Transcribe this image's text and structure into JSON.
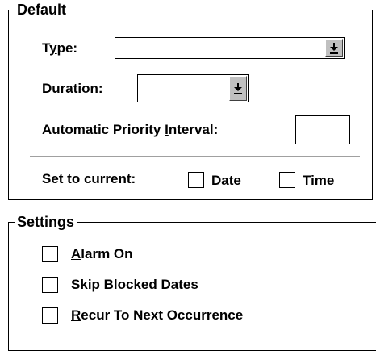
{
  "default_group": {
    "legend": "Default",
    "type_label_pre": "T",
    "type_label_mnemonic": "y",
    "type_label_post": "pe:",
    "type_value": "",
    "duration_label_pre": "D",
    "duration_label_mnemonic": "u",
    "duration_label_post": "ration:",
    "duration_value": "",
    "priority_label_pre": "Automatic Priority ",
    "priority_label_mnemonic": "I",
    "priority_label_post": "nterval:",
    "priority_value": "",
    "set_current_label": "Set to current:",
    "date_mnemonic": "D",
    "date_rest": "ate",
    "time_mnemonic": "T",
    "time_rest": "ime",
    "dropdown_icon": "arrow-down-to-bar-icon"
  },
  "settings_group": {
    "legend": "Settings",
    "alarm_mnemonic": "A",
    "alarm_rest": "larm On",
    "skip_pre": "S",
    "skip_mnemonic": "k",
    "skip_rest": "ip Blocked Dates",
    "recur_mnemonic": "R",
    "recur_rest": "ecur To Next Occurrence"
  }
}
